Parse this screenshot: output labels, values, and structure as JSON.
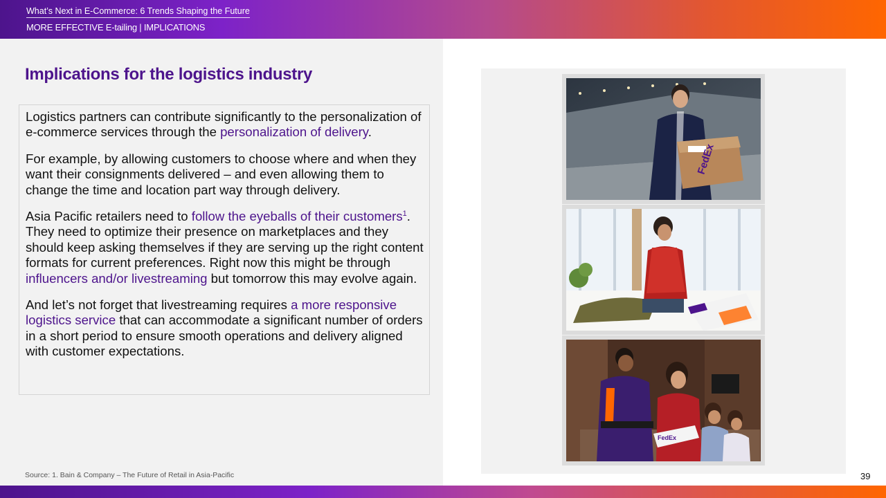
{
  "header": {
    "title": "What’s Next in E-Commerce: 6 Trends Shaping the Future",
    "subtitle": "MORE EFFECTIVE E-tailing | IMPLICATIONS"
  },
  "main": {
    "heading": "Implications for the logistics industry",
    "paragraphs": [
      {
        "p1_a": "Logistics partners can contribute significantly to the personalization of e-commerce services through the ",
        "p1_hl": "personalization of delivery",
        "p1_b": "."
      },
      {
        "p2": "For example, by allowing customers to choose where and when they want their consignments delivered – and even allowing them to change the time and location part way through delivery."
      },
      {
        "p3_a": "Asia Pacific retailers need to ",
        "p3_hl1": "follow the eyeballs of their customers",
        "p3_sup": "1",
        "p3_b": ". They need to optimize their presence on marketplaces and they should keep asking themselves if they are serving up the right content formats for current preferences. Right now this might be through ",
        "p3_hl2": "influencers and/or livestreaming",
        "p3_c": " but tomorrow this may evolve again."
      },
      {
        "p4_a": "And let’s not forget that livestreaming requires ",
        "p4_hl": "a more responsive logistics service",
        "p4_b": " that can accommodate a significant number of orders in a short period to ensure smooth operations and delivery aligned with customer expectations."
      }
    ]
  },
  "footer": {
    "source": "Source: 1. Bain & Company – The Future of Retail in Asia-Pacific",
    "page_number": "39"
  },
  "photos": {
    "photo1_logo": "FedEx",
    "photo3_logo": "FedEx"
  },
  "colors": {
    "brand_purple": "#4d148c",
    "brand_orange": "#ff6600",
    "panel_gray": "#f2f2f2"
  }
}
